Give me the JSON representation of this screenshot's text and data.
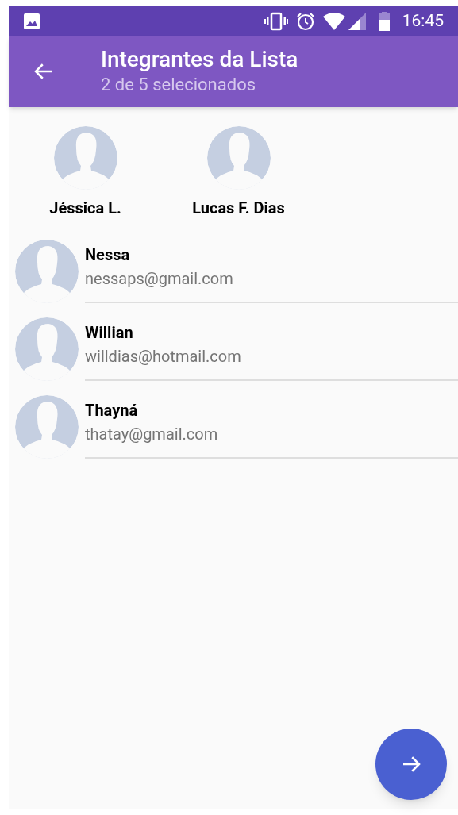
{
  "status_bar": {
    "time": "16:45"
  },
  "app_bar": {
    "title": "Integrantes da Lista",
    "subtitle": "2 de 5 selecionados"
  },
  "selected_members": [
    {
      "name": "Jéssica L."
    },
    {
      "name": "Lucas F. Dias"
    }
  ],
  "contacts": [
    {
      "name": "Nessa",
      "email": "nessaps@gmail.com"
    },
    {
      "name": "Willian",
      "email": "willdias@hotmail.com"
    },
    {
      "name": "Thayná",
      "email": "thatay@gmail.com"
    }
  ]
}
